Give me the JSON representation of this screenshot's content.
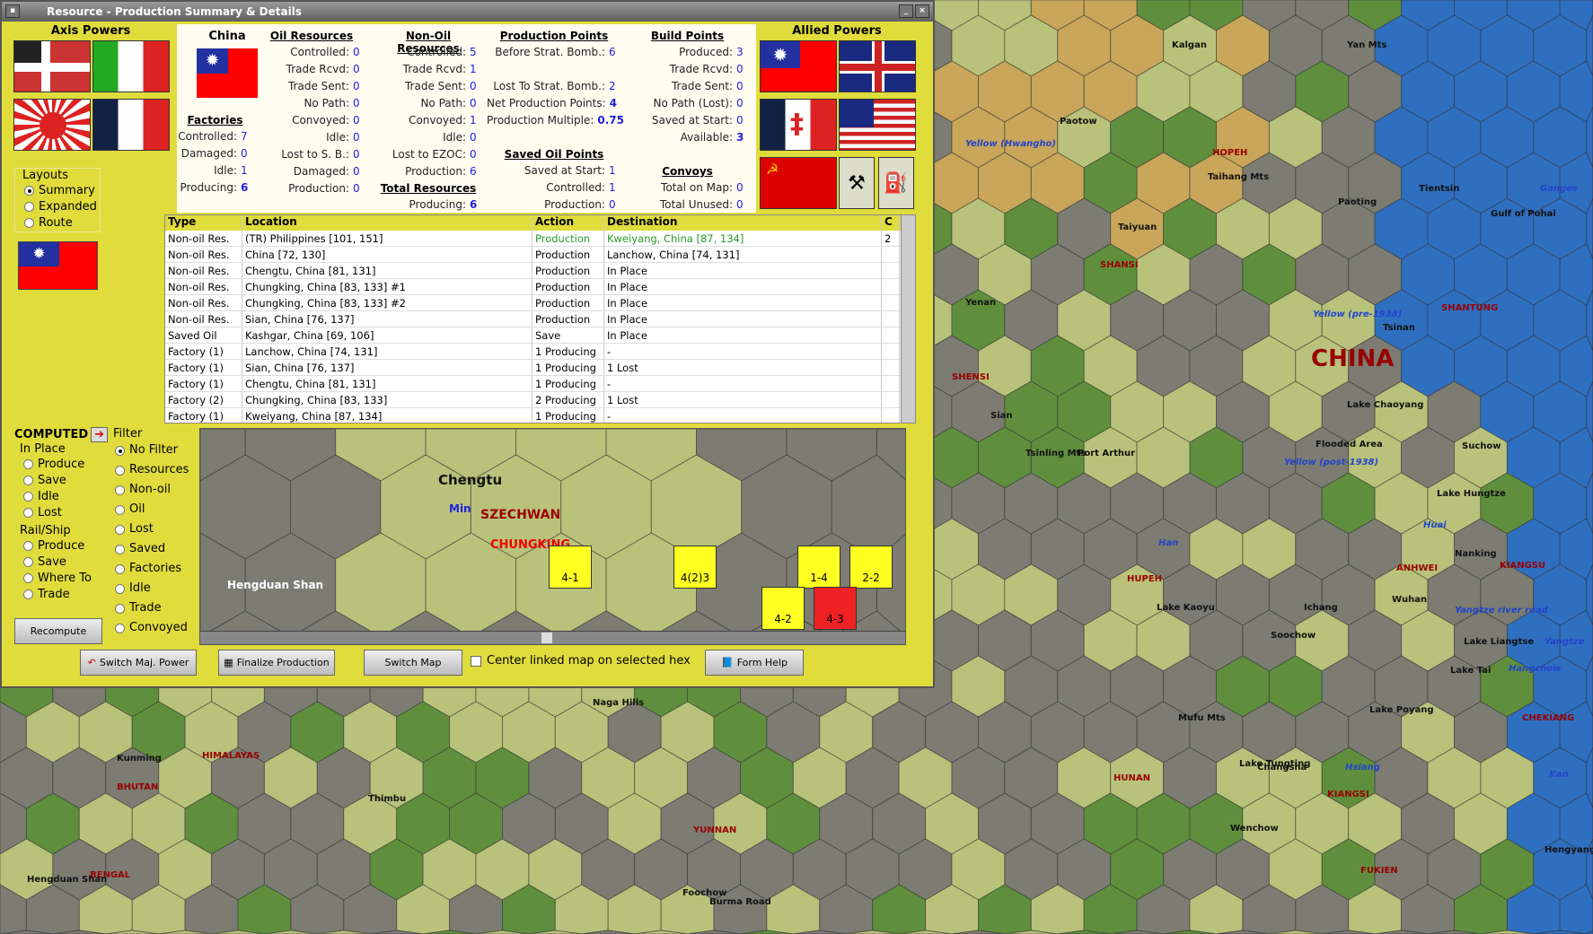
{
  "window": {
    "title": "Resource - Production Summary & Details"
  },
  "axis": {
    "title": "Axis Powers"
  },
  "allied": {
    "title": "Allied Powers"
  },
  "country": {
    "name": "China"
  },
  "factories": {
    "title": "Factories",
    "rows": [
      [
        "Controlled:",
        "7"
      ],
      [
        "Damaged:",
        "0"
      ],
      [
        "Idle:",
        "1"
      ],
      [
        "Producing:",
        "6"
      ]
    ]
  },
  "oil": {
    "title": "Oil Resources",
    "rows": [
      [
        "Controlled:",
        "0"
      ],
      [
        "Trade Rcvd:",
        "0"
      ],
      [
        "Trade Sent:",
        "0"
      ],
      [
        "No Path:",
        "0"
      ],
      [
        "Convoyed:",
        "0"
      ],
      [
        "Idle:",
        "0"
      ],
      [
        "Lost to S. B.:",
        "0"
      ],
      [
        "Damaged:",
        "0"
      ],
      [
        "Production:",
        "0"
      ]
    ]
  },
  "nonoil": {
    "title": "Non-Oil Resources",
    "rows": [
      [
        "Controlled:",
        "5"
      ],
      [
        "Trade Rcvd:",
        "1"
      ],
      [
        "Trade Sent:",
        "0"
      ],
      [
        "No Path:",
        "0"
      ],
      [
        "Convoyed:",
        "1"
      ],
      [
        "Idle:",
        "0"
      ],
      [
        "Lost to EZOC:",
        "0"
      ],
      [
        "Production:",
        "6"
      ]
    ]
  },
  "total": {
    "title": "Total Resources",
    "rows": [
      [
        "Producing:",
        "6"
      ]
    ]
  },
  "pp": {
    "title": "Production Points",
    "rows": [
      [
        "Before Strat. Bomb.:",
        "6"
      ],
      [
        "",
        ""
      ],
      [
        "Lost To Strat. Bomb.:",
        "2"
      ],
      [
        "Net Production Points:",
        "4"
      ],
      [
        "Production Multiple:",
        "0.75"
      ]
    ]
  },
  "saved": {
    "title": "Saved Oil Points",
    "rows": [
      [
        "Saved at Start:",
        "1"
      ],
      [
        "Controlled:",
        "1"
      ],
      [
        "Production:",
        "0"
      ]
    ]
  },
  "bp": {
    "title": "Build Points",
    "rows": [
      [
        "Produced:",
        "3"
      ],
      [
        "Trade Rcvd:",
        "0"
      ],
      [
        "Trade Sent:",
        "0"
      ],
      [
        "No Path (Lost):",
        "0"
      ],
      [
        "Saved at Start:",
        "0"
      ],
      [
        "Available:",
        "3"
      ]
    ]
  },
  "convoys": {
    "title": "Convoys",
    "rows": [
      [
        "Total on Map:",
        "0"
      ],
      [
        "Total Unused:",
        "0"
      ]
    ]
  },
  "layouts": {
    "title": "Layouts",
    "options": [
      "Summary",
      "Expanded",
      "Route"
    ],
    "selected": 0
  },
  "table": {
    "headers": [
      "Type",
      "Location",
      "Action",
      "Destination",
      "C"
    ],
    "rows": [
      [
        "Non-oil Res.",
        "(TR) Philippines [101, 151]",
        "Production",
        "Kweiyang, China [87, 134]",
        "2"
      ],
      [
        "Non-oil Res.",
        "China [72, 130]",
        "Production",
        "Lanchow, China [74, 131]",
        ""
      ],
      [
        "Non-oil Res.",
        "Chengtu, China [81, 131]",
        "Production",
        "In Place",
        ""
      ],
      [
        "Non-oil Res.",
        "Chungking, China [83, 133] #1",
        "Production",
        "In Place",
        ""
      ],
      [
        "Non-oil Res.",
        "Chungking, China [83, 133] #2",
        "Production",
        "In Place",
        ""
      ],
      [
        "Non-oil Res.",
        "Sian, China [76, 137]",
        "Production",
        "In Place",
        ""
      ],
      [
        "Saved Oil",
        "Kashgar, China [69, 106]",
        "Save",
        "In Place",
        ""
      ],
      [
        "Factory (1)",
        "Lanchow, China [74, 131]",
        "1 Producing",
        "-",
        ""
      ],
      [
        "Factory (1)",
        "Sian, China [76, 137]",
        "1 Producing",
        "1 Lost",
        ""
      ],
      [
        "Factory (1)",
        "Chengtu, China [81, 131]",
        "1 Producing",
        "-",
        ""
      ],
      [
        "Factory (2)",
        "Chungking, China [83, 133]",
        "2 Producing",
        "1 Lost",
        ""
      ],
      [
        "Factory (1)",
        "Kweiyang, China [87, 134]",
        "1 Producing",
        "-",
        ""
      ]
    ]
  },
  "computed": {
    "title": "COMPUTED",
    "inplace": "In Place",
    "inplace_opts": [
      "Produce",
      "Save",
      "Idle",
      "Lost"
    ],
    "rail": "Rail/Ship",
    "rail_opts": [
      "Produce",
      "Save",
      "Where To",
      "Trade"
    ],
    "recompute": "Recompute"
  },
  "filter": {
    "title": "Filter",
    "options": [
      "No Filter",
      "Resources",
      "Non-oil",
      "Oil",
      "Lost",
      "Saved",
      "Factories",
      "Idle",
      "Trade",
      "Convoyed"
    ],
    "selected": 0
  },
  "minimap": {
    "labels": [
      "Chengtu",
      "Min",
      "SZECHWAN",
      "CHUNGKING",
      "Hengduan Shan"
    ],
    "units": [
      "4-1",
      "4(2)3",
      "1-4",
      "2-2",
      "4-2",
      "4-3"
    ]
  },
  "buttons": {
    "switch_power": "Switch Maj. Power",
    "finalize": "Finalize Production",
    "switch_map": "Switch Map",
    "center_linked": "Center linked map on selected hex",
    "form_help": "Form Help"
  },
  "map": {
    "labels": [
      "CHINA",
      "HOPEH",
      "SHANSI",
      "SHANTUNG",
      "SHENSI",
      "HUPEH",
      "ANHWEI",
      "KIANGSU",
      "HUNAN",
      "KIANGSI",
      "YUNNAN",
      "BHUTAN",
      "HIMALAYAS",
      "BENGAL",
      "FUKIEN",
      "CHEKIANG",
      "Kalgan",
      "Yan Mts",
      "Paotow",
      "Yellow (Hwangho)",
      "Taihang Mts",
      "Tientsin",
      "Paoting",
      "Taiyuan",
      "Gulf of Pohai",
      "Yenan",
      "Yellow (pre-1938)",
      "Tsinan",
      "Sian",
      "Tsinling Mts",
      "Suchow",
      "Yellow (post-1938)",
      "Lake Chaoyang",
      "Flooded Area",
      "Lake Hungtze",
      "Han",
      "Huai",
      "Nanking",
      "Lake Kaoyu",
      "Ichang",
      "Wuhan",
      "Yangtze river road",
      "Soochow",
      "Lake Liangtse",
      "Yangtze",
      "Lake Tai",
      "Hangchow",
      "Lake Poyang",
      "Mufu Mts",
      "Lake Tungting",
      "Changsha",
      "Hsiang",
      "Kan",
      "Wenchow",
      "Hengyang",
      "Foochow",
      "Burma Road",
      "Kunming",
      "Thimbu",
      "Naga Hills",
      "Hengduan Shan",
      "Ganges",
      "Port Arthur"
    ]
  },
  "colors": {
    "panel": "#e0dc3c",
    "value": "#2222dd"
  }
}
